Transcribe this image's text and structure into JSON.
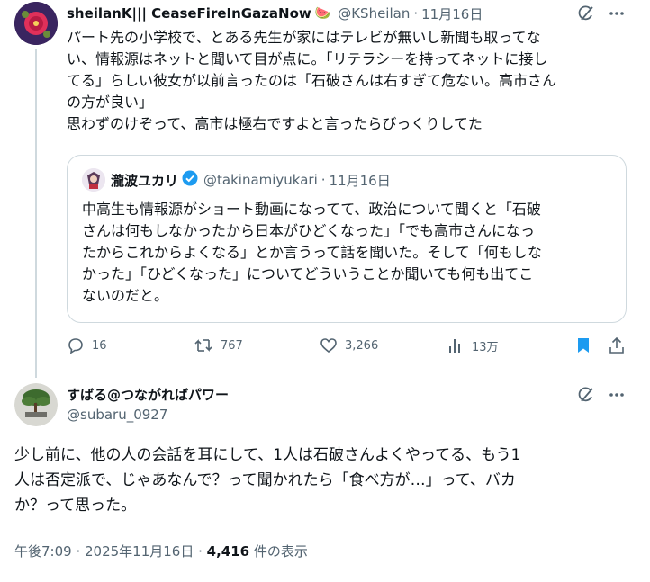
{
  "tweet1": {
    "display_name": "sheilanK||| CeaseFireInGazaNow",
    "name_emoji": "🍉",
    "handle": "@KSheilan",
    "dot": "·",
    "date": "11月16日",
    "text_lines": [
      "パート先の小学校で、とある先生が家にはテレビが無いし新聞も取ってな",
      "い、情報源はネットと聞いて目が点に。「リテラシーを持ってネットに接し",
      "てる」らしい彼女が以前言ったのは「石破さんは右すぎて危ない。高市さん",
      "の方が良い」",
      "思わずのけぞって、高市は極右ですよと言ったらびっくりしてた"
    ],
    "actions": {
      "replies": "16",
      "reposts": "767",
      "likes": "3,266",
      "views": "13万"
    }
  },
  "quote": {
    "display_name": "瀧波ユカリ",
    "handle": "@takinamiyukari",
    "dot": "·",
    "date": "11月16日",
    "text_lines": [
      "中高生も情報源がショート動画になってて、政治について聞くと「石破",
      "さんは何もしなかったから日本がひどくなった」「でも高市さんになっ",
      "たからこれからよくなる」とか言うって話を聞いた。そして「何もしな",
      "かった」「ひどくなった」についてどういうことか聞いても何も出てこ",
      "ないのだと。"
    ]
  },
  "tweet2": {
    "display_name": "すばる@つながればパワー",
    "handle": "@subaru_0927",
    "text_lines": [
      "少し前に、他の人の会話を耳にして、1人は石破さんよくやってる、もう1",
      "人は否定派で、じゃあなんで？って聞かれたら「食べ方が…」って、バカ",
      "か？って思った。"
    ],
    "timestamp": "午後7:09 · 2025年11月16日 · ",
    "views_count": "4,416",
    "views_label": " 件の表示"
  },
  "colors": {
    "text": "#0f1419",
    "secondary": "#536471",
    "border": "#cfd9de",
    "verified": "#1d9bf0",
    "bookmark": "#1d9bf0"
  },
  "icons": [
    "grok-icon",
    "more-icon",
    "reply-icon",
    "repost-icon",
    "like-icon",
    "views-icon",
    "bookmark-icon",
    "share-icon",
    "verified-badge-icon"
  ]
}
